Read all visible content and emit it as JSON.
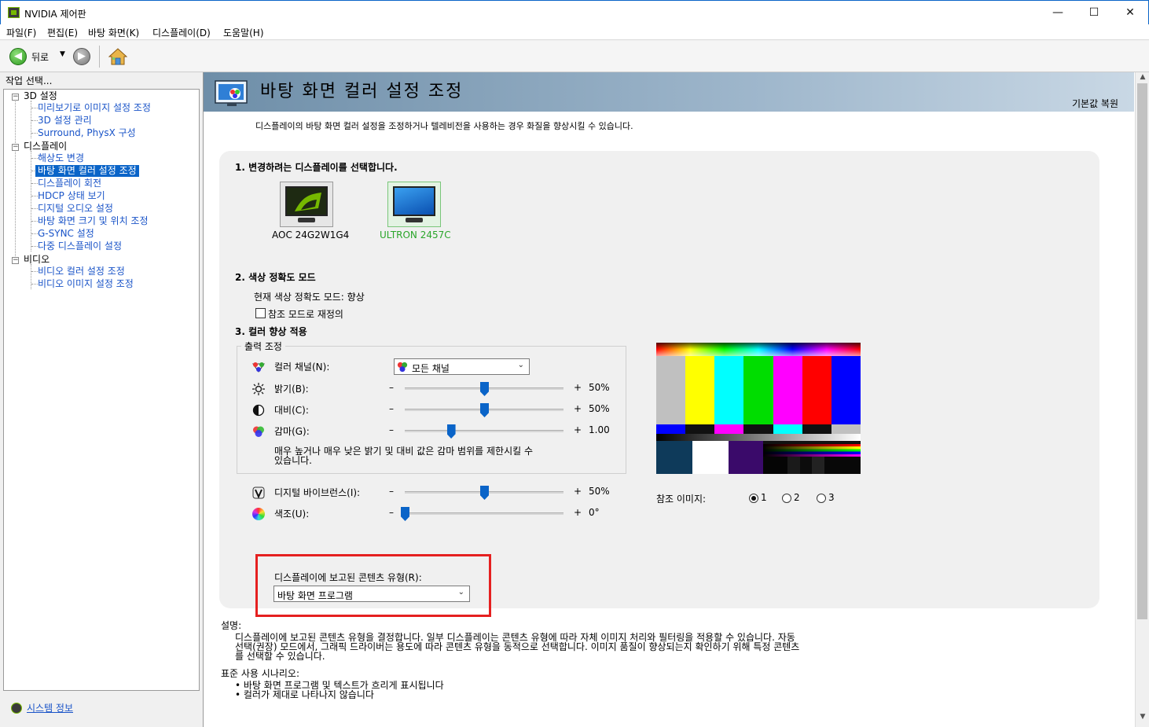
{
  "window": {
    "title": "NVIDIA 제어판",
    "min": "—",
    "max": "☐",
    "close": "✕"
  },
  "menu": [
    "파일(F)",
    "편집(E)",
    "바탕 화면(K)",
    "디스플레이(D)",
    "도움말(H)"
  ],
  "toolbar": {
    "back_label": "뒤로",
    "dropdown": "▼"
  },
  "left": {
    "heading": "작업 선택...",
    "groups": [
      {
        "label": "3D 설정",
        "items": [
          "미리보기로 이미지 설정 조정",
          "3D 설정 관리",
          "Surround, PhysX 구성"
        ]
      },
      {
        "label": "디스플레이",
        "items": [
          "해상도 변경",
          "바탕 화면 컬러 설정 조정",
          "디스플레이 회전",
          "HDCP 상태 보기",
          "디지털 오디오 설정",
          "바탕 화면 크기 및 위치 조정",
          "G-SYNC 설정",
          "다중 디스플레이 설정"
        ]
      },
      {
        "label": "비디오",
        "items": [
          "비디오 컬러 설정 조정",
          "비디오 이미지 설정 조정"
        ]
      }
    ],
    "system_info": "시스템 정보"
  },
  "page": {
    "title": "바탕 화면 컬러 설정 조정",
    "restore_defaults": "기본값 복원",
    "description": "디스플레이의 바탕 화면 컬러 설정을 조정하거나 텔레비전을 사용하는 경우 화질을 향상시킬 수 있습니다."
  },
  "section1": {
    "title": "1. 변경하려는 디스플레이를 선택합니다.",
    "displays": [
      "AOC 24G2W1G4",
      "ULTRON 2457C"
    ],
    "selected_color": "#2aa52a"
  },
  "section2": {
    "title": "2. 색상 정확도 모드",
    "current_mode": "현재 색상 정확도 모드: 향상",
    "override_checkbox": "참조 모드로 재정의"
  },
  "section3": {
    "title": "3. 컬러 향상 적용",
    "group_title": "출력 조정",
    "channel_label": "컬러 채널(N):",
    "channel_value": "모든 채널",
    "sliders": [
      {
        "label": "밝기(B):",
        "value": "50%",
        "pos": 0.5
      },
      {
        "label": "대비(C):",
        "value": "50%",
        "pos": 0.5
      },
      {
        "label": "감마(G):",
        "value": "1.00",
        "pos": 0.29
      }
    ],
    "gamma_note_1": "매우 높거나 매우 낮은 밝기 및 대비 값은 감마 범위를 제한시킬 수",
    "gamma_note_2": "있습니다.",
    "sliders2": [
      {
        "label": "디지털 바이브런스(I):",
        "value": "50%",
        "pos": 0.5
      },
      {
        "label": "색조(U):",
        "value": "0°",
        "pos": 0.0
      }
    ],
    "minus": "–",
    "plus": "+"
  },
  "reference": {
    "label": "참조 이미지:",
    "options": [
      "1",
      "2",
      "3"
    ],
    "selected": "1"
  },
  "content_type": {
    "label": "디스플레이에 보고된 콘텐츠 유형(R):",
    "value": "바탕 화면 프로그램"
  },
  "explanation": {
    "heading": "설명:",
    "lines": [
      "디스플레이에 보고된 콘텐츠 유형을 결정합니다. 일부 디스플레이는 콘텐츠 유형에 따라 자체 이미지 처리와 필터링을 적용할 수 있습니다. 자동",
      "선택(권장) 모드에서, 그래픽 드라이버는 용도에 따라 콘텐츠 유형을 동적으로 선택합니다. 이미지 품질이 향상되는지 확인하기 위해 특정 콘텐츠",
      "를 선택할 수 있습니다."
    ],
    "scenario_heading": "표준 사용 시나리오:",
    "scenarios": [
      "• 바탕 화면 프로그램 및 텍스트가 흐리게 표시됩니다",
      "• 컬러가 제대로 나타나지 않습니다"
    ]
  },
  "colors": {
    "accent": "#0a64c8",
    "link": "#1a54c8",
    "highlight": "#e52020",
    "nvidia_green": "#76b900"
  }
}
